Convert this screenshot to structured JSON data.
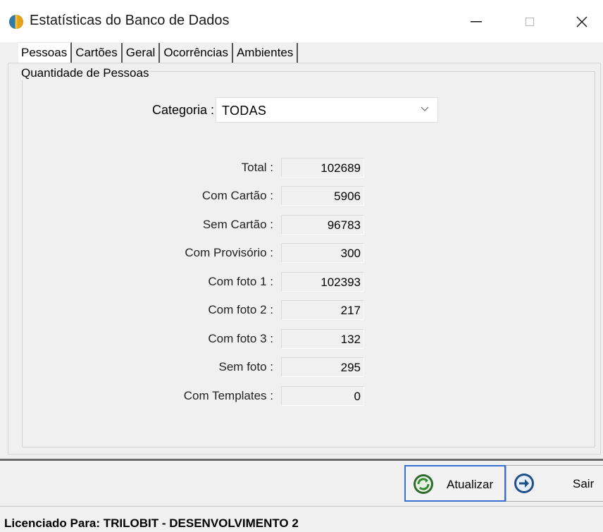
{
  "window": {
    "title": "Estatísticas do Banco de Dados",
    "minimize_glyph": "—",
    "maximize_glyph": "□",
    "close_glyph": "✕"
  },
  "tabs": [
    {
      "label": "Pessoas",
      "active": true
    },
    {
      "label": "Cartões",
      "active": false
    },
    {
      "label": "Geral",
      "active": false
    },
    {
      "label": "Ocorrências",
      "active": false
    },
    {
      "label": "Ambientes",
      "active": false
    }
  ],
  "group": {
    "title": "Quantidade de Pessoas"
  },
  "category": {
    "label": "Categoria :",
    "value": "TODAS"
  },
  "stats": [
    {
      "label": "Total :",
      "value": "102689"
    },
    {
      "label": "Com Cartão :",
      "value": "5906"
    },
    {
      "label": "Sem Cartão :",
      "value": "96783"
    },
    {
      "label": "Com Provisório :",
      "value": "300"
    },
    {
      "label": "Com foto 1 :",
      "value": "102393"
    },
    {
      "label": "Com foto 2 :",
      "value": "217"
    },
    {
      "label": "Com foto 3 :",
      "value": "132"
    },
    {
      "label": "Sem foto :",
      "value": "295"
    },
    {
      "label": "Com Templates :",
      "value": "0"
    }
  ],
  "buttons": {
    "atualizar": "Atualizar",
    "sair": "Sair"
  },
  "status": {
    "text": "Licenciado Para: TRILOBIT - DESENVOLVIMENTO 2"
  },
  "icons": {
    "app": "app-globe-icon",
    "refresh": "refresh-icon",
    "exit": "exit-arrow-icon"
  },
  "colors": {
    "accent_border": "#3b6fd0",
    "window_bg": "#f0f0f0"
  }
}
